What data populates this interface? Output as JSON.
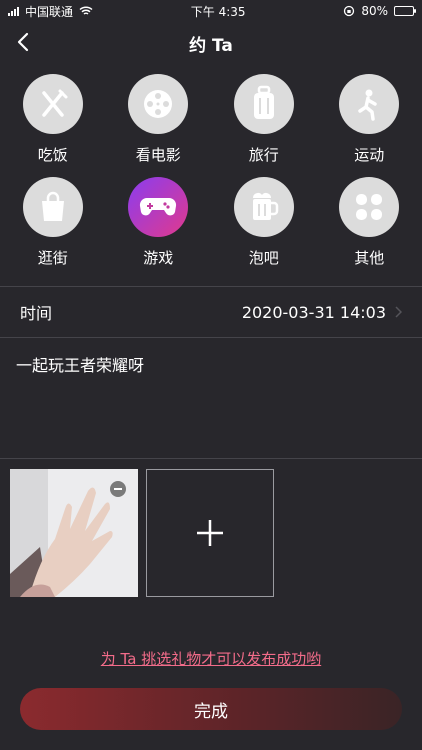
{
  "status": {
    "carrier": "中国联通",
    "time": "下午 4:35",
    "battery": "80%",
    "battery_level": 0.8
  },
  "nav": {
    "title": "约 Ta"
  },
  "categories": [
    {
      "label": "吃饭",
      "icon": "utensils-icon"
    },
    {
      "label": "看电影",
      "icon": "film-reel-icon"
    },
    {
      "label": "旅行",
      "icon": "luggage-icon"
    },
    {
      "label": "运动",
      "icon": "running-icon"
    },
    {
      "label": "逛街",
      "icon": "shopping-bag-icon"
    },
    {
      "label": "游戏",
      "icon": "gamepad-icon"
    },
    {
      "label": "泡吧",
      "icon": "beer-mug-icon"
    },
    {
      "label": "其他",
      "icon": "grid-dots-icon"
    }
  ],
  "time_row": {
    "label": "时间",
    "value": "2020-03-31 14:03"
  },
  "note": {
    "text": "一起玩王者荣耀呀"
  },
  "gift_link": "为 Ta 挑选礼物才可以发布成功哟",
  "done_button": "完成",
  "colors": {
    "background": "#28272c",
    "accent_link": "#f36c8a",
    "active_gradient_start": "#8a3cf0",
    "active_gradient_end": "#e13a8c"
  }
}
